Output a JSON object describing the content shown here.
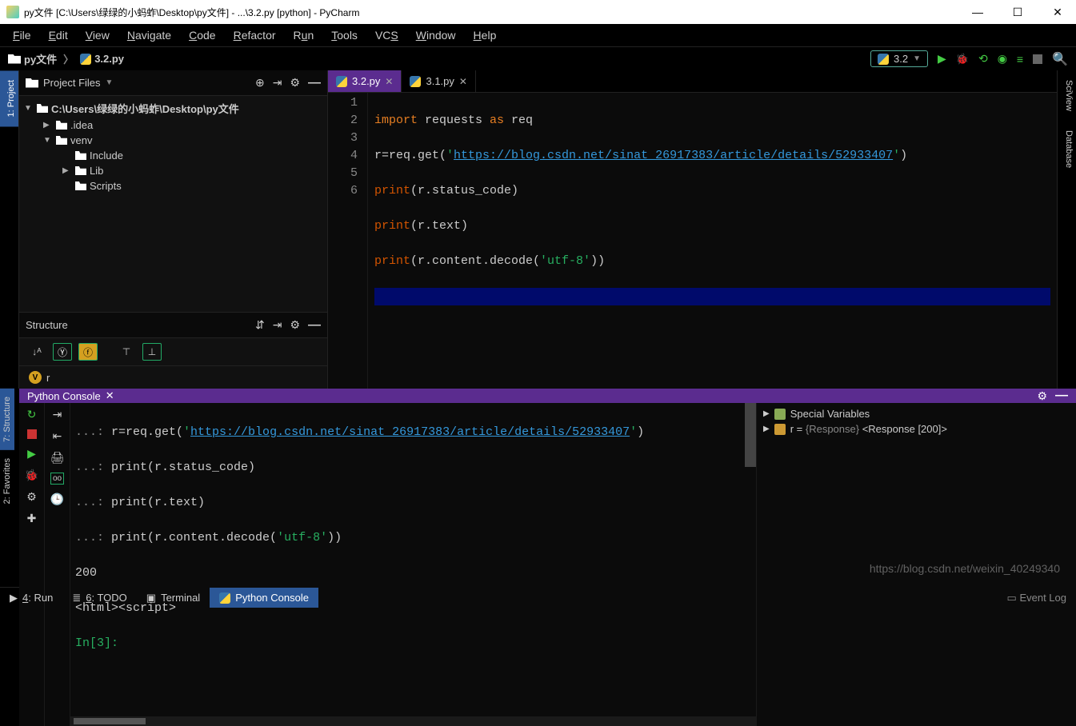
{
  "titlebar": {
    "title": "py文件 [C:\\Users\\绿绿的小蚂蚱\\Desktop\\py文件] - ...\\3.2.py [python] - PyCharm",
    "min": "—",
    "max": "☐",
    "close": "✕"
  },
  "menu": {
    "file": "File",
    "edit": "Edit",
    "view": "View",
    "navigate": "Navigate",
    "code": "Code",
    "refactor": "Refactor",
    "run": "Run",
    "tools": "Tools",
    "vcs": "VCS",
    "window": "Window",
    "help": "Help"
  },
  "breadcrumb": {
    "root": "py文件",
    "file": "3.2.py"
  },
  "runconfig": {
    "name": "3.2"
  },
  "left_rail": {
    "project": "1: Project"
  },
  "project_panel": {
    "title": "Project Files",
    "root": "C:\\Users\\绿绿的小蚂蚱\\Desktop\\py文件",
    "idea": ".idea",
    "venv": "venv",
    "include": "Include",
    "lib": "Lib",
    "scripts": "Scripts"
  },
  "structure": {
    "title": "Structure",
    "item": "r"
  },
  "tabs": {
    "t1": "3.2.py",
    "t2": "3.1.py"
  },
  "code": {
    "l1a": "import",
    "l1b": " requests ",
    "l1c": "as",
    "l1d": " req",
    "l2a": "r=req.get(",
    "l2b": "'",
    "l2c": "https://blog.csdn.net/sinat_26917383/article/details/52933407",
    "l2d": "'",
    "l2e": ")",
    "l3a": "print",
    "l3b": "(r.status_code)",
    "l4a": "print",
    "l4b": "(r.text)",
    "l5a": "print",
    "l5b": "(r.content.decode(",
    "l5c": "'utf-8'",
    "l5d": "))",
    "gutter": [
      "1",
      "2",
      "3",
      "4",
      "5",
      "6"
    ]
  },
  "right_rail": {
    "sciview": "SciView",
    "database": "Database"
  },
  "console_rail": {
    "structure": "7: Structure",
    "favorites": "2: Favorites"
  },
  "console": {
    "title": "Python Console",
    "dots": "...: ",
    "c1a": "r=req.get(",
    "c1b": "'",
    "c1c": "https://blog.csdn.net/sinat_26917383/article/details/52933407",
    "c1d": "'",
    "c1e": ")",
    "c2": "print(r.status_code)",
    "c3": "print(r.text)",
    "c4a": "print(r.content.decode(",
    "c4b": "'utf-8'",
    "c4c": "))",
    "out1": "200",
    "out2": "<html><script>",
    "prompt": "In[3]: "
  },
  "vars": {
    "special": "Special Variables",
    "r_name": "r = ",
    "r_type": "{Response} ",
    "r_val": "<Response [200]>"
  },
  "bottombar": {
    "run": "4: Run",
    "todo": "6: TODO",
    "terminal": "Terminal",
    "pyconsole": "Python Console",
    "eventlog": "Event Log"
  },
  "watermark": "https://blog.csdn.net/weixin_40249340"
}
